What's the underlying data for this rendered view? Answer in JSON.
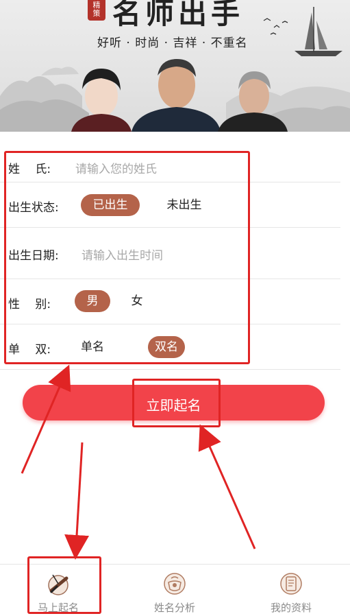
{
  "banner": {
    "seal": "精\n策",
    "title": "名师出手",
    "subtitle": "好听 · 时尚 · 吉祥 · 不重名"
  },
  "form": {
    "surname": {
      "label": "姓　 氏:",
      "placeholder": "请输入您的姓氏",
      "value": ""
    },
    "birth_status": {
      "label": "出生状态:",
      "options": [
        "已出生",
        "未出生"
      ],
      "selected": "已出生"
    },
    "birth_date": {
      "label": "出生日期:",
      "placeholder": "请输入出生时间",
      "value": ""
    },
    "gender": {
      "label": "性　 别:",
      "options": [
        "男",
        "女"
      ],
      "selected": "男"
    },
    "name_length": {
      "label": "单　 双:",
      "options": [
        "单名",
        "双名"
      ],
      "selected": "双名"
    }
  },
  "cta": {
    "label": "立即起名"
  },
  "tabbar": {
    "items": [
      {
        "label": "马上起名",
        "icon": "brush-icon",
        "active": true
      },
      {
        "label": "姓名分析",
        "icon": "tea-icon",
        "active": false
      },
      {
        "label": "我的资料",
        "icon": "scroll-icon",
        "active": false
      }
    ]
  },
  "colors": {
    "accent": "#b4634a",
    "cta": "#f2434a",
    "annotation": "#e02424"
  }
}
